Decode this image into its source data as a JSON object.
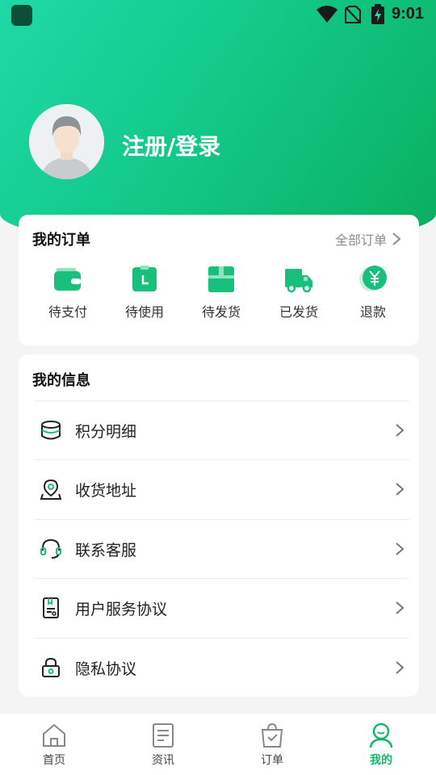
{
  "status": {
    "time": "9:01"
  },
  "user": {
    "login_label": "注册/登录"
  },
  "orders": {
    "title": "我的订单",
    "all_label": "全部订单",
    "items": [
      {
        "label": "待支付",
        "icon": "wallet-icon"
      },
      {
        "label": "待使用",
        "icon": "clock-doc-icon"
      },
      {
        "label": "待发货",
        "icon": "package-icon"
      },
      {
        "label": "已发货",
        "icon": "truck-icon"
      },
      {
        "label": "退款",
        "icon": "refund-yen-icon"
      }
    ]
  },
  "info": {
    "title": "我的信息",
    "items": [
      {
        "label": "积分明细",
        "icon": "coins-stack-icon"
      },
      {
        "label": "收货地址",
        "icon": "map-pin-icon"
      },
      {
        "label": "联系客服",
        "icon": "headset-icon"
      },
      {
        "label": "用户服务协议",
        "icon": "document-icon"
      },
      {
        "label": "隐私协议",
        "icon": "lock-icon"
      }
    ]
  },
  "tabs": [
    {
      "label": "首页",
      "icon": "home-icon",
      "active": false
    },
    {
      "label": "资讯",
      "icon": "news-icon",
      "active": false
    },
    {
      "label": "订单",
      "icon": "order-bag-icon",
      "active": false
    },
    {
      "label": "我的",
      "icon": "profile-icon",
      "active": true
    }
  ],
  "colors": {
    "accent": "#12b96c",
    "gradient_start": "#1fd9a6",
    "gradient_end": "#0aae5e"
  }
}
